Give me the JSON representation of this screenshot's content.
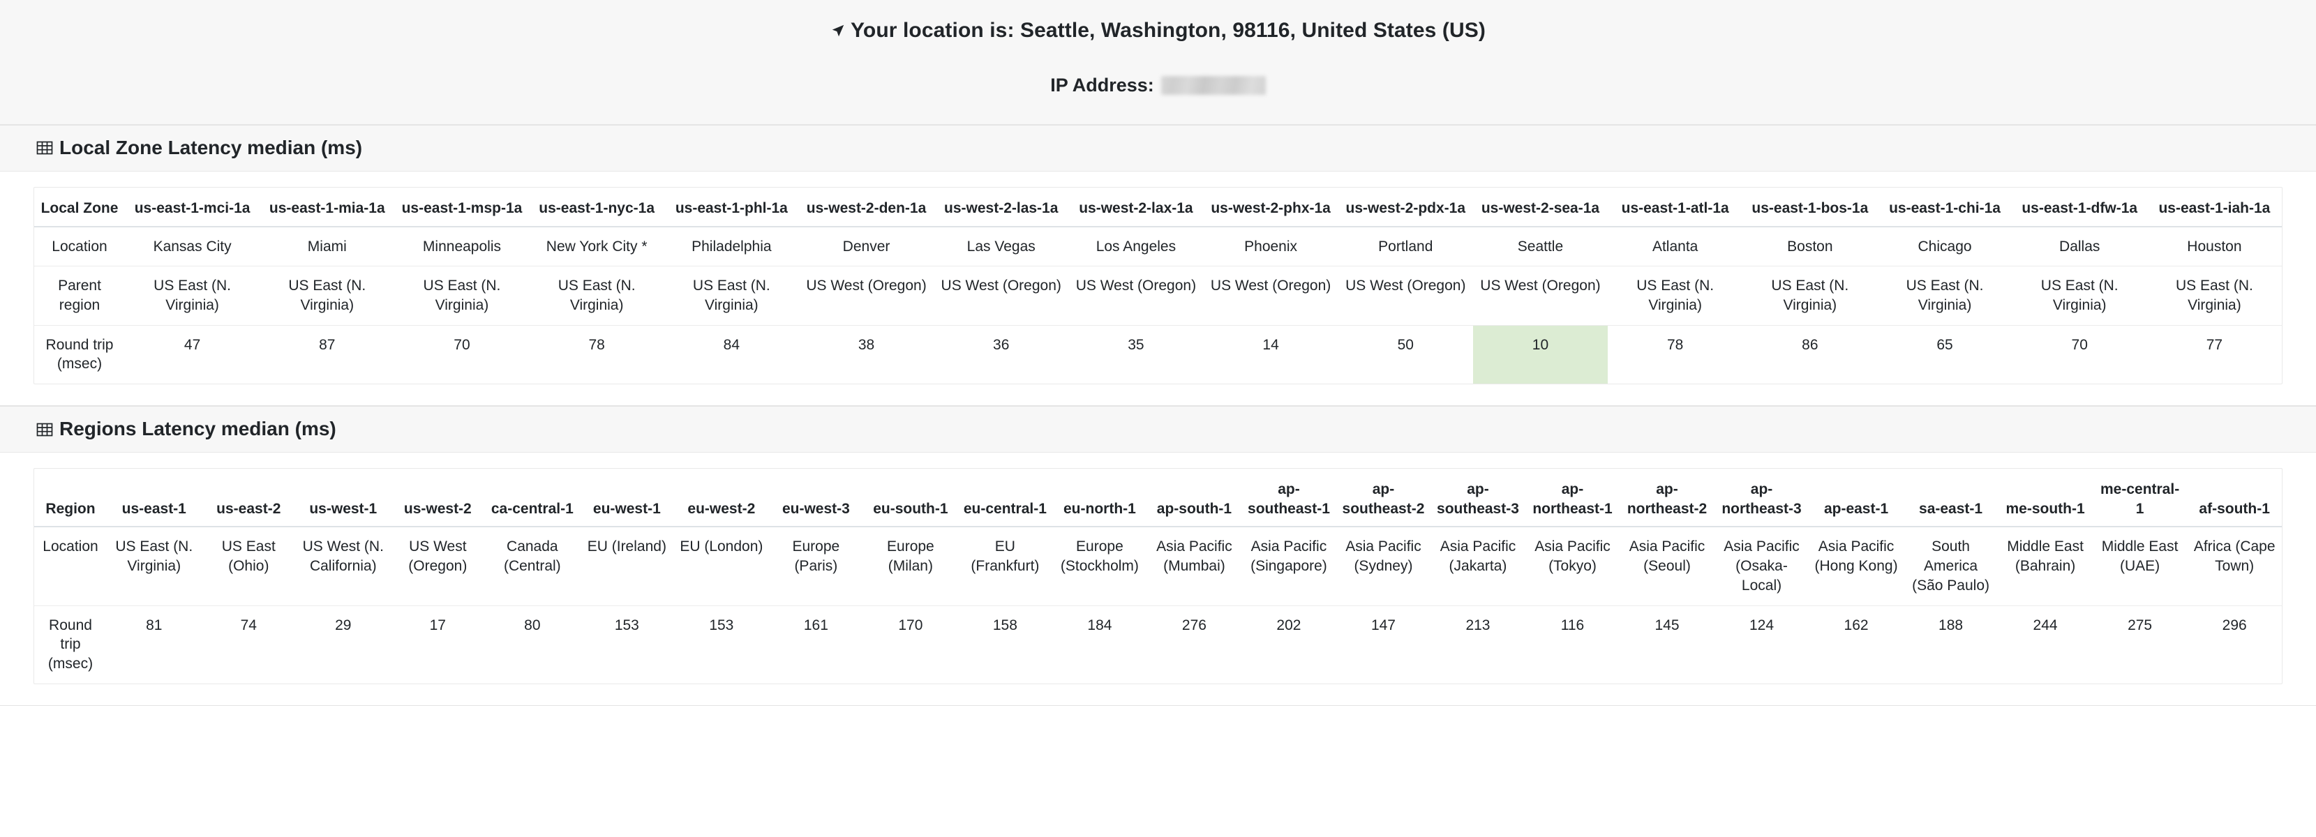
{
  "header": {
    "location_icon": "navigation-arrow-icon",
    "location_text": "Your location is: Seattle, Washington, 98116, United States (US)",
    "ip_label": "IP Address:",
    "ip_value_redacted": true
  },
  "local_zone_section": {
    "icon": "table-grid-icon",
    "title": "Local Zone Latency median (ms)",
    "row_labels": {
      "header": "Local Zone",
      "location": "Location",
      "parent_region": "Parent region",
      "round_trip": "Round trip (msec)"
    },
    "highlight_color": "#dcecd3",
    "highlight_column": "us-west-2-sea-1a",
    "columns": [
      {
        "zone": "us-east-1-mci-1a",
        "location": "Kansas City",
        "parent": "US East (N. Virginia)",
        "rtt": "47"
      },
      {
        "zone": "us-east-1-mia-1a",
        "location": "Miami",
        "parent": "US East (N. Virginia)",
        "rtt": "87"
      },
      {
        "zone": "us-east-1-msp-1a",
        "location": "Minneapolis",
        "parent": "US East (N. Virginia)",
        "rtt": "70"
      },
      {
        "zone": "us-east-1-nyc-1a",
        "location": "New York City *",
        "parent": "US East (N. Virginia)",
        "rtt": "78"
      },
      {
        "zone": "us-east-1-phl-1a",
        "location": "Philadelphia",
        "parent": "US East (N. Virginia)",
        "rtt": "84"
      },
      {
        "zone": "us-west-2-den-1a",
        "location": "Denver",
        "parent": "US West (Oregon)",
        "rtt": "38"
      },
      {
        "zone": "us-west-2-las-1a",
        "location": "Las Vegas",
        "parent": "US West (Oregon)",
        "rtt": "36"
      },
      {
        "zone": "us-west-2-lax-1a",
        "location": "Los Angeles",
        "parent": "US West (Oregon)",
        "rtt": "35"
      },
      {
        "zone": "us-west-2-phx-1a",
        "location": "Phoenix",
        "parent": "US West (Oregon)",
        "rtt": "14"
      },
      {
        "zone": "us-west-2-pdx-1a",
        "location": "Portland",
        "parent": "US West (Oregon)",
        "rtt": "50"
      },
      {
        "zone": "us-west-2-sea-1a",
        "location": "Seattle",
        "parent": "US West (Oregon)",
        "rtt": "10",
        "highlight": true
      },
      {
        "zone": "us-east-1-atl-1a",
        "location": "Atlanta",
        "parent": "US East (N. Virginia)",
        "rtt": "78"
      },
      {
        "zone": "us-east-1-bos-1a",
        "location": "Boston",
        "parent": "US East (N. Virginia)",
        "rtt": "86"
      },
      {
        "zone": "us-east-1-chi-1a",
        "location": "Chicago",
        "parent": "US East (N. Virginia)",
        "rtt": "65"
      },
      {
        "zone": "us-east-1-dfw-1a",
        "location": "Dallas",
        "parent": "US East (N. Virginia)",
        "rtt": "70"
      },
      {
        "zone": "us-east-1-iah-1a",
        "location": "Houston",
        "parent": "US East (N. Virginia)",
        "rtt": "77"
      }
    ]
  },
  "regions_section": {
    "icon": "table-grid-icon",
    "title": "Regions Latency median (ms)",
    "row_labels": {
      "header": "Region",
      "location": "Location",
      "round_trip": "Round trip (msec)"
    },
    "columns": [
      {
        "region": "us-east-1",
        "location": "US East (N. Virginia)",
        "rtt": "81"
      },
      {
        "region": "us-east-2",
        "location": "US East (Ohio)",
        "rtt": "74"
      },
      {
        "region": "us-west-1",
        "location": "US West (N. California)",
        "rtt": "29"
      },
      {
        "region": "us-west-2",
        "location": "US West (Oregon)",
        "rtt": "17"
      },
      {
        "region": "ca-central-1",
        "location": "Canada (Central)",
        "rtt": "80"
      },
      {
        "region": "eu-west-1",
        "location": "EU (Ireland)",
        "rtt": "153"
      },
      {
        "region": "eu-west-2",
        "location": "EU (London)",
        "rtt": "153"
      },
      {
        "region": "eu-west-3",
        "location": "Europe (Paris)",
        "rtt": "161"
      },
      {
        "region": "eu-south-1",
        "location": "Europe (Milan)",
        "rtt": "170"
      },
      {
        "region": "eu-central-1",
        "location": "EU (Frankfurt)",
        "rtt": "158"
      },
      {
        "region": "eu-north-1",
        "location": "Europe (Stockholm)",
        "rtt": "184"
      },
      {
        "region": "ap-south-1",
        "location": "Asia Pacific (Mumbai)",
        "rtt": "276"
      },
      {
        "region": "ap-southeast-1",
        "location": "Asia Pacific (Singapore)",
        "rtt": "202"
      },
      {
        "region": "ap-southeast-2",
        "location": "Asia Pacific (Sydney)",
        "rtt": "147"
      },
      {
        "region": "ap-southeast-3",
        "location": "Asia Pacific (Jakarta)",
        "rtt": "213"
      },
      {
        "region": "ap-northeast-1",
        "location": "Asia Pacific (Tokyo)",
        "rtt": "116"
      },
      {
        "region": "ap-northeast-2",
        "location": "Asia Pacific (Seoul)",
        "rtt": "145"
      },
      {
        "region": "ap-northeast-3",
        "location": "Asia Pacific (Osaka-Local)",
        "rtt": "124"
      },
      {
        "region": "ap-east-1",
        "location": "Asia Pacific (Hong Kong)",
        "rtt": "162"
      },
      {
        "region": "sa-east-1",
        "location": "South America (São Paulo)",
        "rtt": "188"
      },
      {
        "region": "me-south-1",
        "location": "Middle East (Bahrain)",
        "rtt": "244"
      },
      {
        "region": "me-central-1",
        "location": "Middle East (UAE)",
        "rtt": "275"
      },
      {
        "region": "af-south-1",
        "location": "Africa (Cape Town)",
        "rtt": "296"
      }
    ]
  }
}
